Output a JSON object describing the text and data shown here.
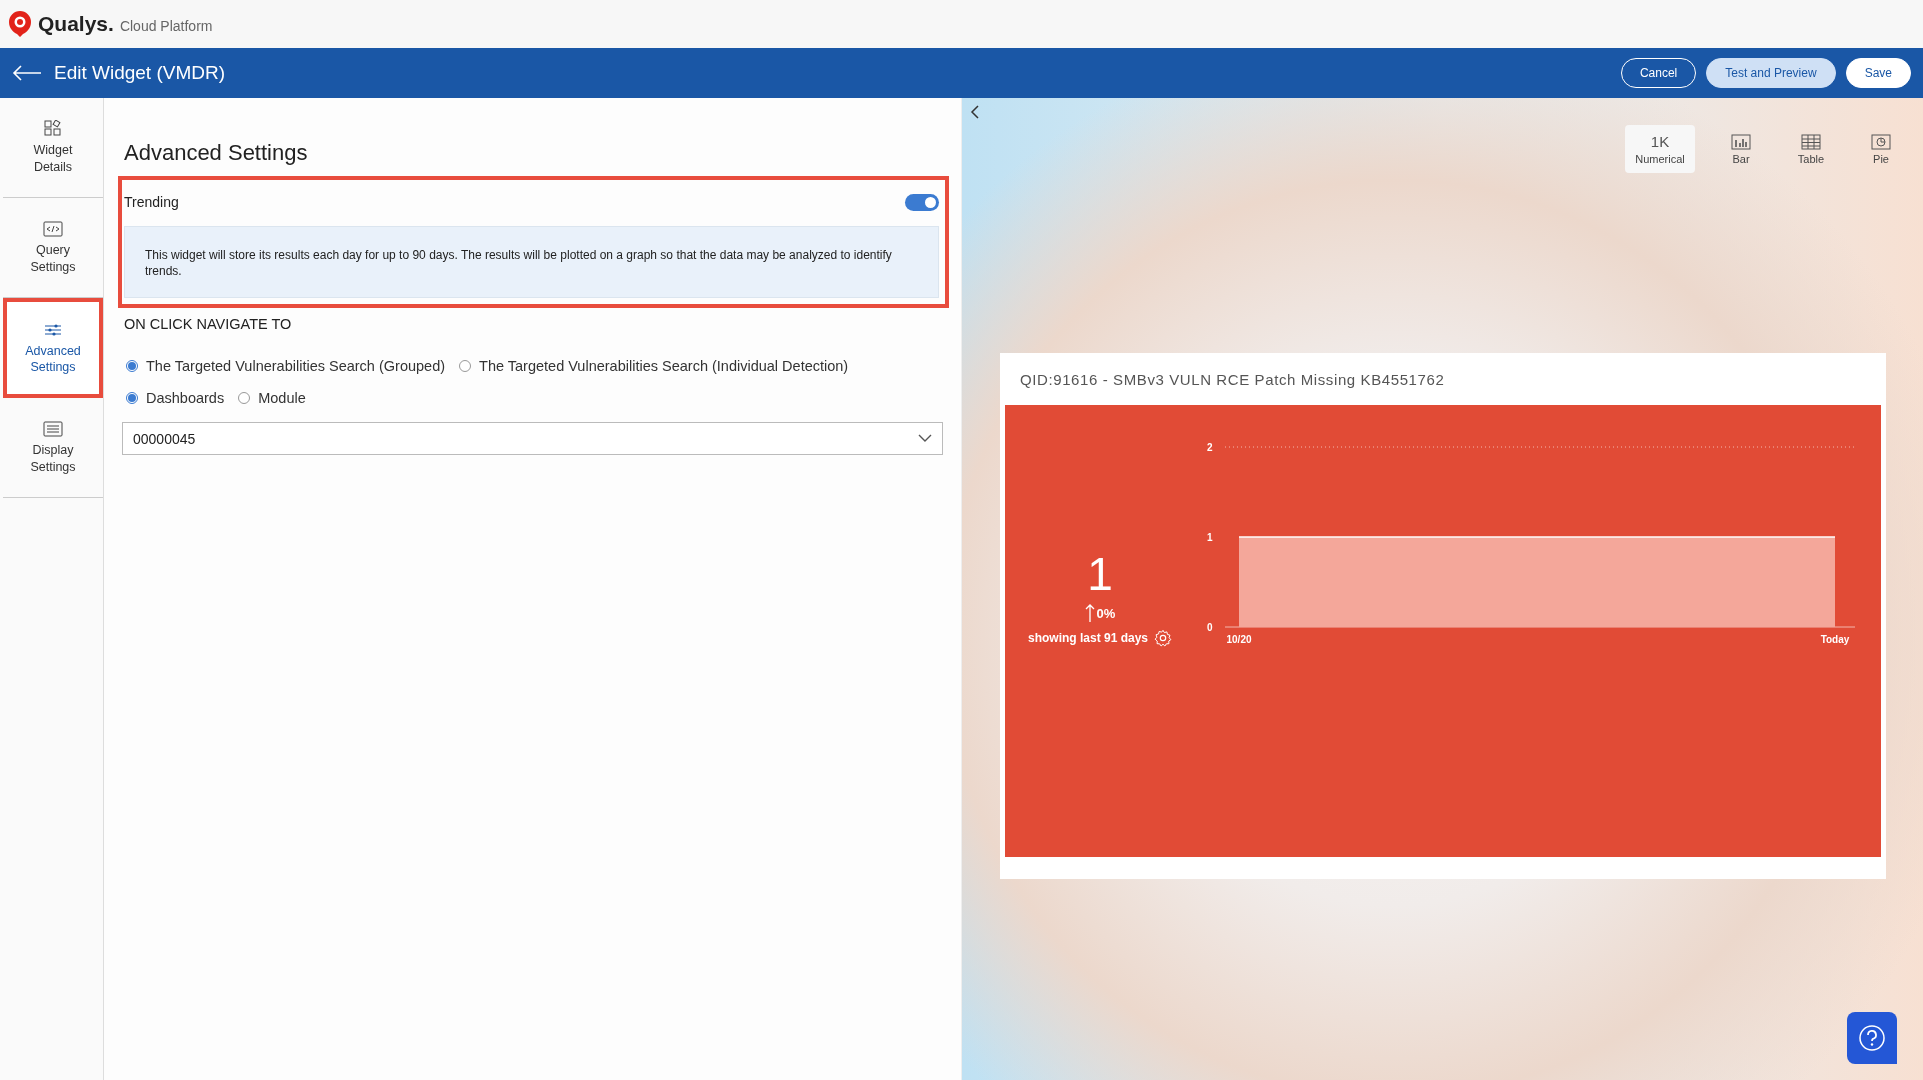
{
  "brand": {
    "name": "Qualys.",
    "product": "Cloud Platform"
  },
  "header": {
    "title": "Edit Widget (VMDR)",
    "buttons": [
      {
        "label": "Cancel",
        "kind": "outline"
      },
      {
        "label": "Test and Preview",
        "kind": "light"
      },
      {
        "label": "Save",
        "kind": "solid"
      }
    ]
  },
  "sidebar": {
    "items": [
      {
        "label": "Widget Details",
        "selected": false,
        "highlighted": false
      },
      {
        "label": "Query Settings",
        "selected": false,
        "highlighted": false
      },
      {
        "label": "Advanced Settings",
        "selected": true,
        "highlighted": true
      },
      {
        "label": "Display Settings",
        "selected": false,
        "highlighted": false
      }
    ]
  },
  "settings": {
    "title": "Advanced Settings",
    "trending": {
      "label": "Trending",
      "on": true,
      "highlighted": true,
      "description": "This widget will store its results each day for up to 90 days. The results will be plotted on a graph so that the data may be analyzed to identify trends."
    },
    "navigate_heading": "ON CLICK NAVIGATE TO",
    "radio_groups": [
      [
        {
          "label": "The Targeted Vulnerabilities Search (Grouped)",
          "selected": true
        },
        {
          "label": "The Targeted Vulnerabilities Search (Individual Detection)",
          "selected": false
        }
      ],
      [
        {
          "label": "Dashboards",
          "selected": true
        },
        {
          "label": "Module",
          "selected": false
        }
      ]
    ],
    "dropdown": {
      "value": "00000045"
    }
  },
  "chart_types": [
    {
      "label": "Numerical",
      "symbol": "1K",
      "selected": true
    },
    {
      "label": "Bar",
      "selected": false
    },
    {
      "label": "Table",
      "selected": false
    },
    {
      "label": "Pie",
      "selected": false
    }
  ],
  "widget": {
    "title": "QID:91616 - SMBv3 VULN RCE Patch Missing KB4551762",
    "value": "1",
    "trend": "0%",
    "period": "showing last 91 days",
    "chart_data": {
      "type": "area",
      "categories": [
        "10/20",
        "Today"
      ],
      "series": [
        {
          "color": "#f4a79a",
          "values": [
            1,
            1
          ]
        }
      ],
      "ylim": [
        0,
        2
      ],
      "yticks": [
        0,
        1,
        2
      ]
    }
  }
}
